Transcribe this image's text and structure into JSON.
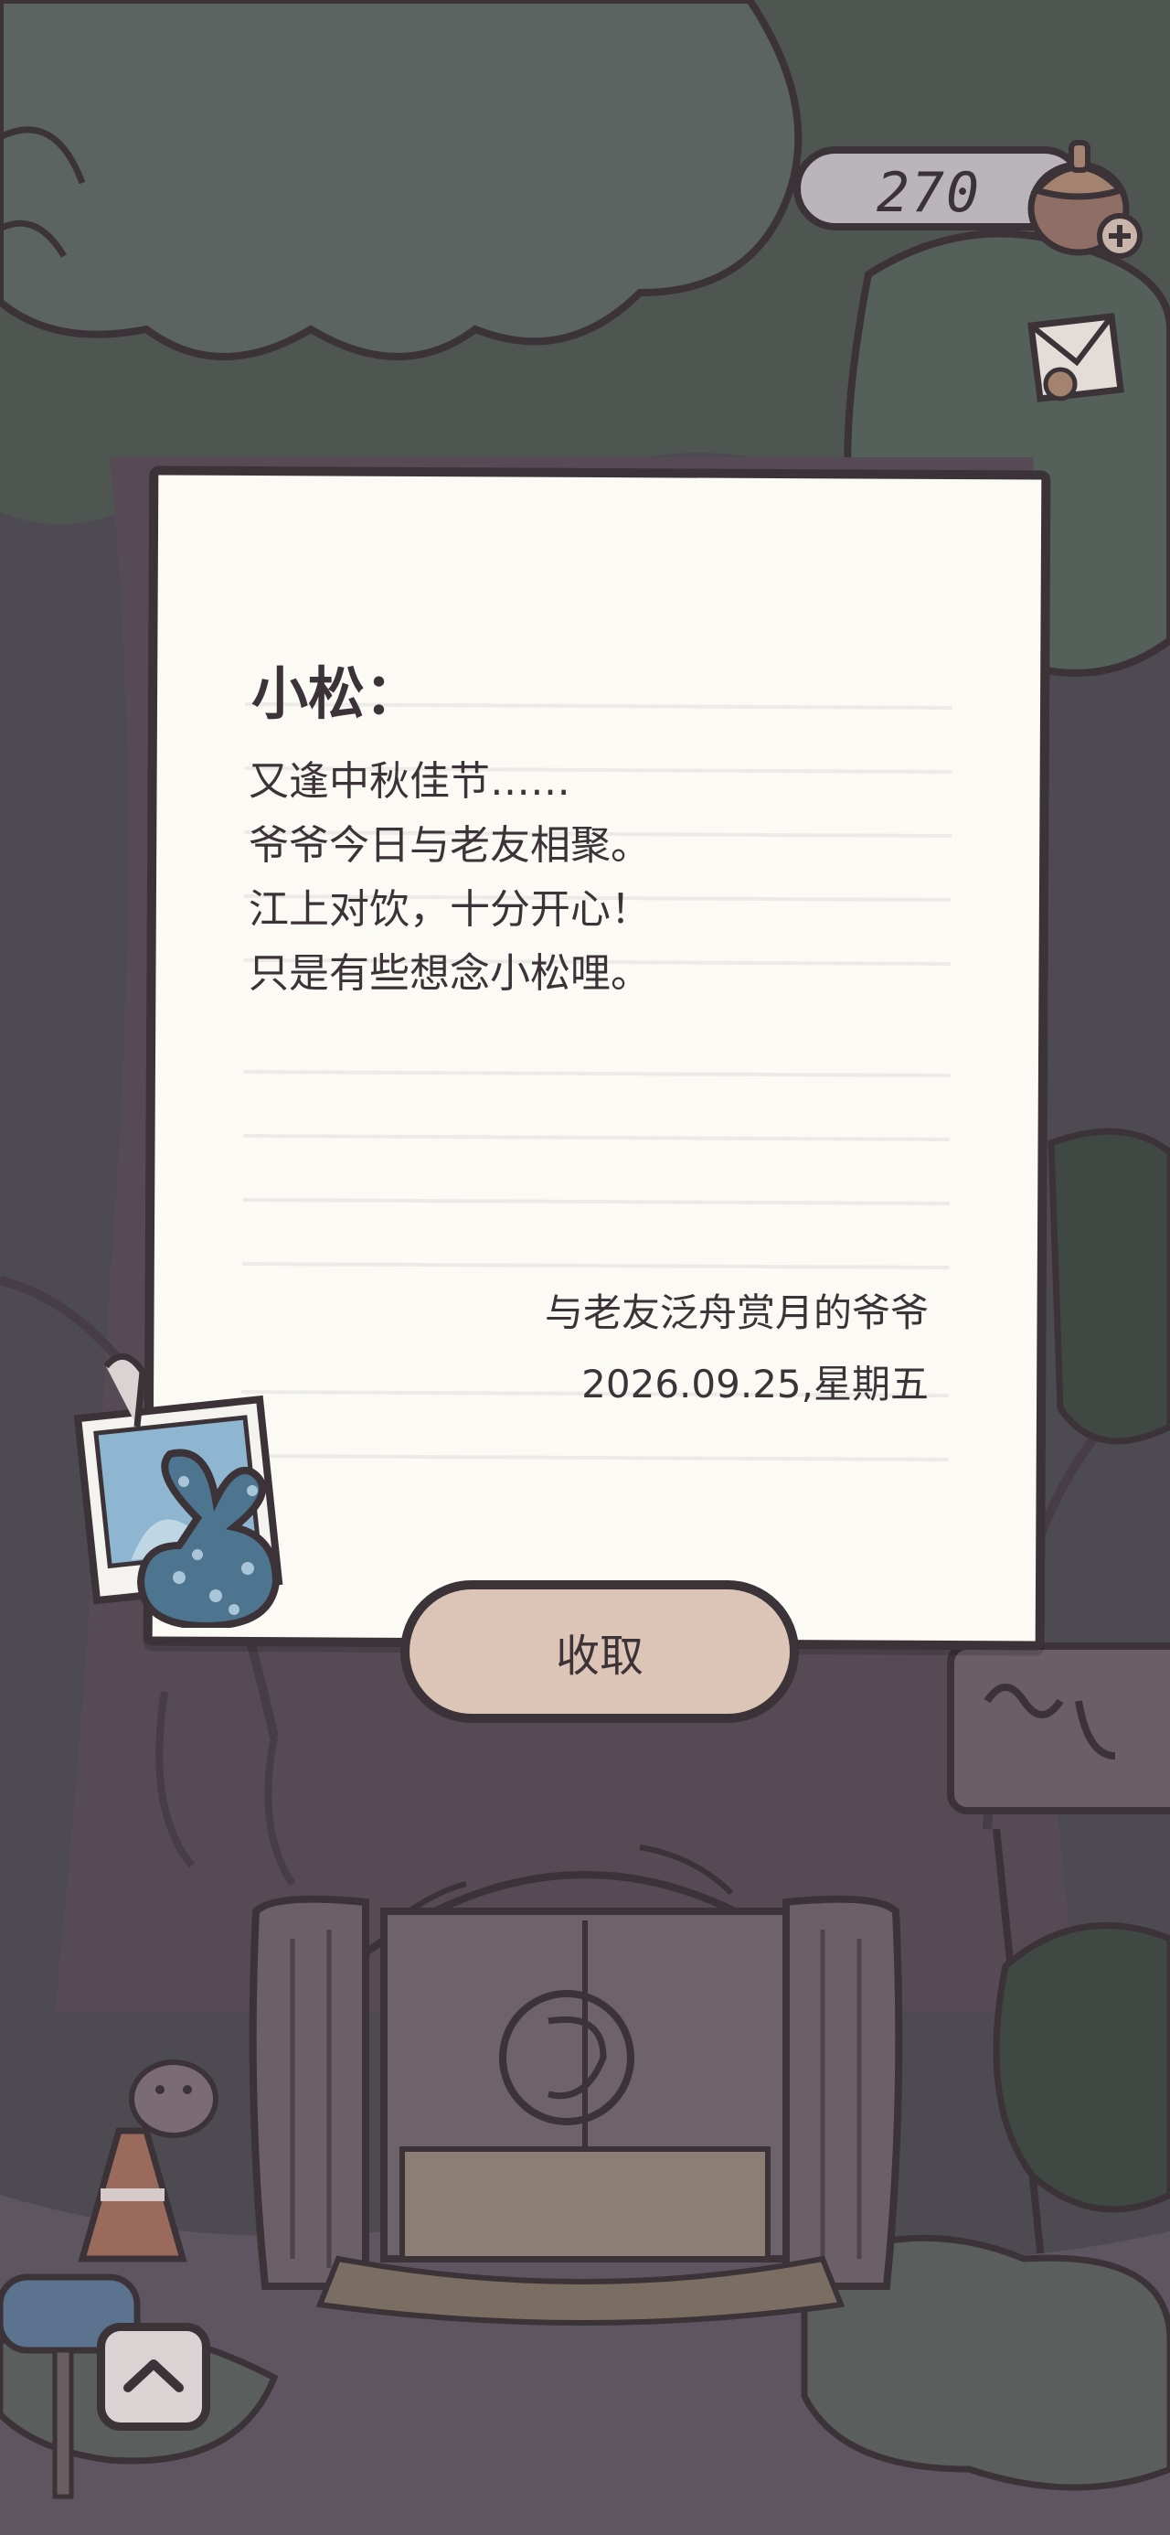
{
  "hud": {
    "acorn_count": "270",
    "acorn_icon": "acorn-plus-icon",
    "mail_icon": "letter-icon"
  },
  "letter": {
    "salutation": "小松：",
    "lines": [
      "又逢中秋佳节……",
      "爷爷今日与老友相聚。",
      "江上对饮，十分开心！",
      "只是有些想念小松哩。"
    ],
    "signature": "与老友泛舟赏月的爷爷",
    "date": "2026.09.25,星期五",
    "attachment_icon": "bundle-photo-icon"
  },
  "actions": {
    "collect_label": "收取",
    "scroll_up_icon": "chevron-up-icon"
  },
  "colors": {
    "outline": "#3b3338",
    "paper": "#fbfaf5",
    "button": "#dcc5b6",
    "bundle": "#4d7590"
  }
}
